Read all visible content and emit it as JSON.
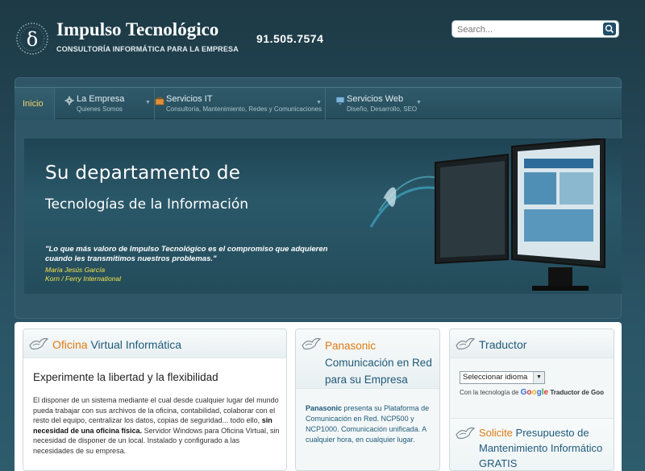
{
  "header": {
    "logo_title": "Impulso Tecnológico",
    "logo_subtitle": "CONSULTORÍA INFORMÁTICA PARA LA EMPRESA",
    "phone": "91.505.7574",
    "search_placeholder": "Search..."
  },
  "nav": {
    "home": "Inicio",
    "items": [
      {
        "title": "La Empresa",
        "desc": "Quienes Somos",
        "icon": "gear-icon"
      },
      {
        "title": "Servicios IT",
        "desc": "Consultoría, Mantenimiento, Redes y Comunicaciones",
        "icon": "briefcase-icon"
      },
      {
        "title": "Servicios Web",
        "desc": "Diseño, Desarrollo, SEO",
        "icon": "monitor-icon"
      }
    ]
  },
  "banner": {
    "title_line1": "Su departamento de",
    "title_line2": "Tecnologías de la Información",
    "quote": "\"Lo que más valoro de Impulso Tecnológico es el compromiso que adquieren cuando les transmitimos nuestros problemas.\"",
    "author_name": "María Jesús García",
    "author_company": "Korn / Ferry International"
  },
  "boxes": {
    "oficina": {
      "title_highlight": "Oficina",
      "title_rest": "Virtual Informática",
      "heading": "Experimente la libertad y la flexibilidad",
      "para_start": "El disponer de un sistema mediante el cual desde cualquier lugar del mundo pueda trabajar con sus archivos de la oficina, contabilidad, colaborar con el resto del equipo, centralizar los datos, copias de seguridad... todo ello,",
      "para_bold": "sin necesidad de una oficina física.",
      "para_end": "Servidor Windows para Oficina Virtual, sin necesidad de disponer de un local. Instalado y configurado a las necesidades de su empresa."
    },
    "panasonic": {
      "title_highlight": "Panasonic",
      "title_rest": "Comunicación en Red para su Empresa",
      "para_bold": "Panasonic",
      "para_rest": "presenta su Plataforma de Comunicación en Red. NCP500 y NCP1000. Comunicación unificada. A cualquier hora, en cualquier lugar."
    },
    "traductor": {
      "title": "Traductor",
      "select_value": "Seleccionar idioma",
      "powered_by": "Con la tecnología de",
      "google": "Google",
      "translate": "Traductor de Goo"
    },
    "solicite": {
      "title_highlight": "Solicite",
      "title_rest": "Presupuesto de Mantenimiento Informático GRATIS"
    }
  },
  "colors": {
    "accent_orange": "#e07b12",
    "link_blue": "#1f5a79",
    "home_yellow": "#f3d36b",
    "author_yellow": "#f2e14d"
  }
}
